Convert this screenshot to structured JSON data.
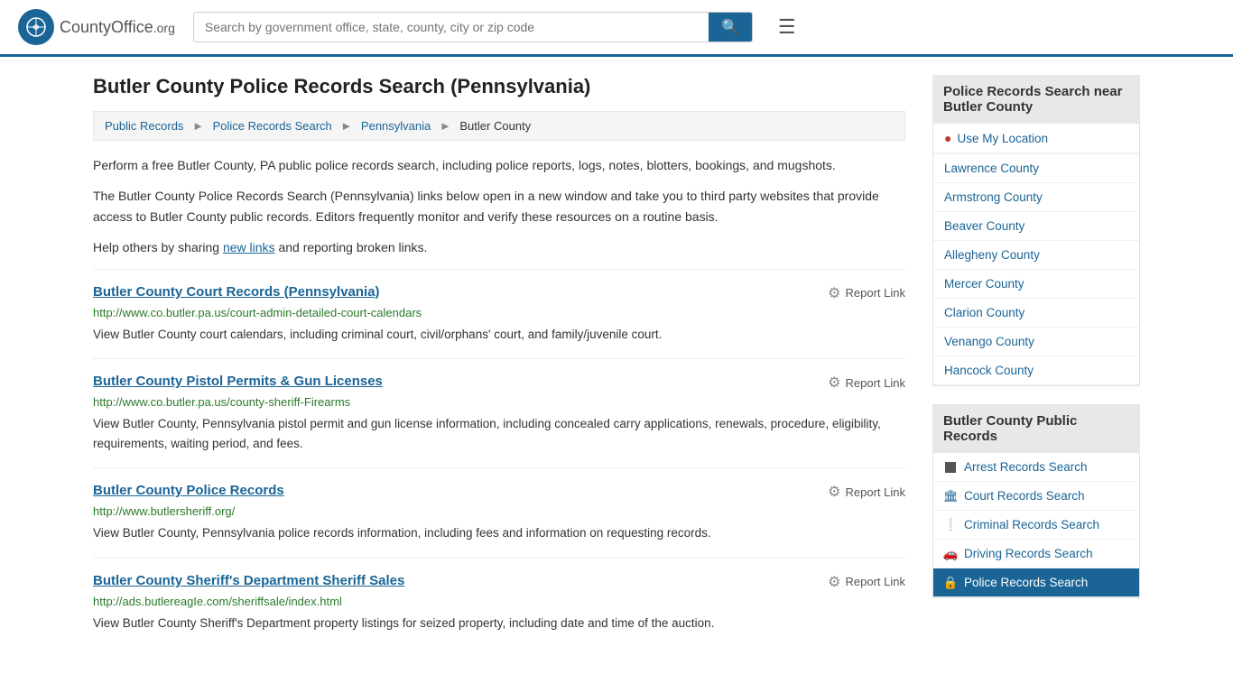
{
  "header": {
    "logo_text": "CountyOffice",
    "logo_suffix": ".org",
    "search_placeholder": "Search by government office, state, county, city or zip code"
  },
  "page": {
    "title": "Butler County Police Records Search (Pennsylvania)",
    "breadcrumb": [
      "Public Records",
      "Police Records Search",
      "Pennsylvania",
      "Butler County"
    ],
    "intro1": "Perform a free Butler County, PA public police records search, including police reports, logs, notes, blotters, bookings, and mugshots.",
    "intro2": "The Butler County Police Records Search (Pennsylvania) links below open in a new window and take you to third party websites that provide access to Butler County public records. Editors frequently monitor and verify these resources on a routine basis.",
    "intro3_pre": "Help others by sharing ",
    "intro3_link": "new links",
    "intro3_post": " and reporting broken links."
  },
  "results": [
    {
      "title": "Butler County Court Records (Pennsylvania)",
      "url": "http://www.co.butler.pa.us/court-admin-detailed-court-calendars",
      "desc": "View Butler County court calendars, including criminal court, civil/orphans' court, and family/juvenile court.",
      "report_label": "Report Link"
    },
    {
      "title": "Butler County Pistol Permits & Gun Licenses",
      "url": "http://www.co.butler.pa.us/county-sheriff-Firearms",
      "desc": "View Butler County, Pennsylvania pistol permit and gun license information, including concealed carry applications, renewals, procedure, eligibility, requirements, waiting period, and fees.",
      "report_label": "Report Link"
    },
    {
      "title": "Butler County Police Records",
      "url": "http://www.butlersheriff.org/",
      "desc": "View Butler County, Pennsylvania police records information, including fees and information on requesting records.",
      "report_label": "Report Link"
    },
    {
      "title": "Butler County Sheriff's Department Sheriff Sales",
      "url": "http://ads.butlereagIe.com/sheriffsale/index.html",
      "desc": "View Butler County Sheriff's Department property listings for seized property, including date and time of the auction.",
      "report_label": "Report Link"
    }
  ],
  "sidebar": {
    "nearby_title": "Police Records Search near Butler County",
    "nearby_items": [
      "Lawrence County",
      "Armstrong County",
      "Beaver County",
      "Allegheny County",
      "Mercer County",
      "Clarion County",
      "Venango County",
      "Hancock County"
    ],
    "public_records_title": "Butler County Public Records",
    "public_records_items": [
      {
        "label": "Arrest Records Search",
        "icon": "square",
        "active": false
      },
      {
        "label": "Court Records Search",
        "icon": "building",
        "active": false
      },
      {
        "label": "Criminal Records Search",
        "icon": "exclamation",
        "active": false
      },
      {
        "label": "Driving Records Search",
        "icon": "car",
        "active": false
      },
      {
        "label": "Police Records Search",
        "icon": "shield",
        "active": true
      }
    ]
  }
}
